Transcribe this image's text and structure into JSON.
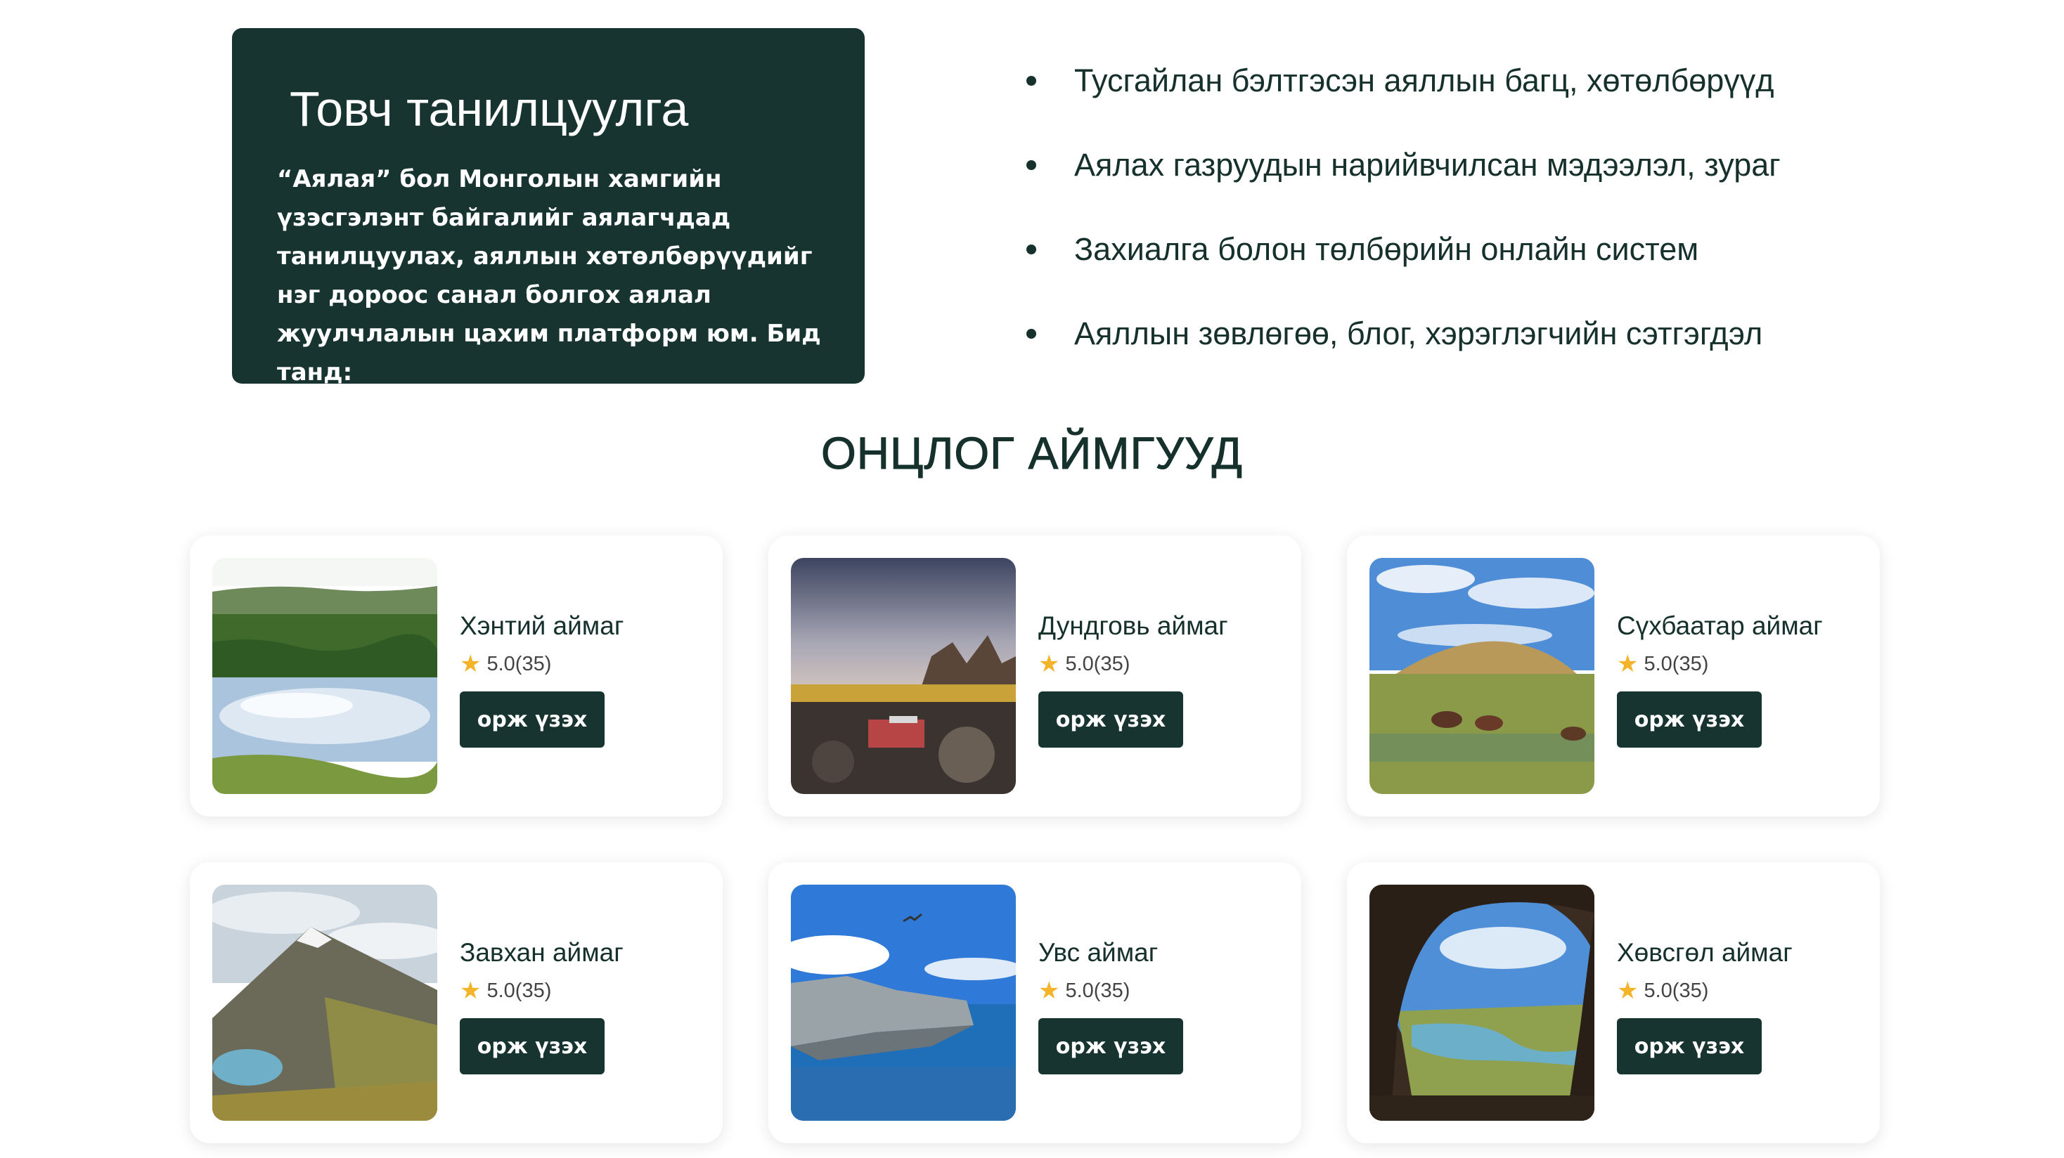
{
  "intro": {
    "title": "Товч танилцуулга",
    "text": "“Аялая” бол Монголын хамгийн үзэсгэлэнт байгалийг аялагчдад танилцуулах, аяллын хөтөлбөрүүдийг нэг дороос санал болгох аялал жуулчлалын цахим платформ юм. Бид танд:"
  },
  "features": [
    "Тусгайлан бэлтгэсэн аяллын багц, хөтөлбөрүүд",
    "Аялах газруудын нарийвчилсан мэдээлэл, зураг",
    "Захиалга болон төлбөрийн онлайн систем",
    "Аяллын зөвлөгөө, блог, хэрэглэгчийн сэтгэгдэл"
  ],
  "section_title": "ОНЦЛОГ АЙМГУУД",
  "provinces": [
    {
      "name": "Хэнтий аймаг",
      "rating": "5.0(35)",
      "button": "орж үзэх",
      "image": "lake-forest-photo"
    },
    {
      "name": "Дундговь аймаг",
      "rating": "5.0(35)",
      "button": "орж үзэх",
      "image": "festival-rocks-photo"
    },
    {
      "name": "Сүхбаатар аймаг",
      "rating": "5.0(35)",
      "button": "орж үзэх",
      "image": "steppe-horses-photo"
    },
    {
      "name": "Завхан аймаг",
      "rating": "5.0(35)",
      "button": "орж үзэх",
      "image": "snow-mountain-photo"
    },
    {
      "name": "Увс аймаг",
      "rating": "5.0(35)",
      "button": "орж үзэх",
      "image": "lake-rocks-photo"
    },
    {
      "name": "Хөвсгөл аймаг",
      "rating": "5.0(35)",
      "button": "орж үзэх",
      "image": "cave-river-photo"
    }
  ],
  "colors": {
    "primary": "#183430",
    "star": "#f3b42a"
  }
}
